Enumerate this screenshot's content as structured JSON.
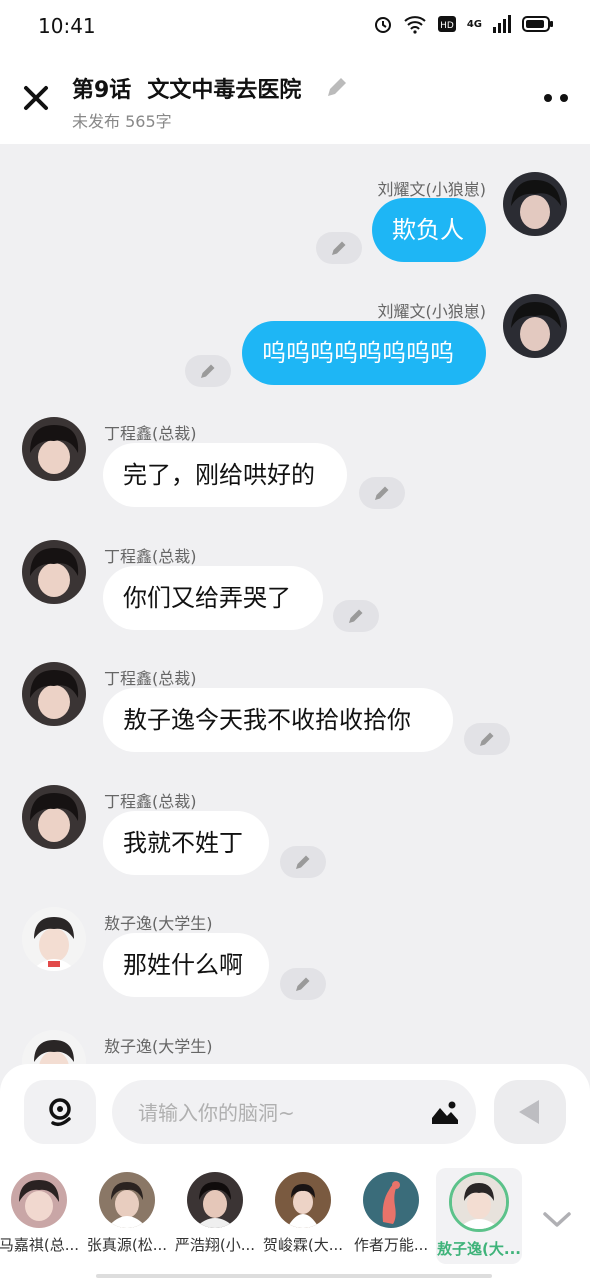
{
  "status": {
    "time": "10:41",
    "network_label": "4G"
  },
  "header": {
    "title_num": "第9话",
    "title_text": "文文中毒去医院",
    "subtitle": "未发布 565字"
  },
  "messages": [
    {
      "side": "right",
      "name": "刘耀文(小狼崽)",
      "text": "欺负人",
      "avatar": "dark"
    },
    {
      "side": "right",
      "name": "刘耀文(小狼崽)",
      "text": "呜呜呜呜呜呜呜呜",
      "avatar": "dark"
    },
    {
      "side": "left",
      "name": "丁程鑫(总裁)",
      "text": "完了，刚给哄好的",
      "avatar": "dark"
    },
    {
      "side": "left",
      "name": "丁程鑫(总裁)",
      "text": "你们又给弄哭了",
      "avatar": "dark"
    },
    {
      "side": "left",
      "name": "丁程鑫(总裁)",
      "text": "敖子逸今天我不收拾收拾你",
      "avatar": "dark"
    },
    {
      "side": "left",
      "name": "丁程鑫(总裁)",
      "text": "我就不姓丁",
      "avatar": "dark"
    },
    {
      "side": "left",
      "name": "敖子逸(大学生)",
      "text": "那姓什么啊",
      "avatar": "light"
    },
    {
      "side": "left",
      "name": "敖子逸(大学生)",
      "text": "",
      "avatar": "light"
    }
  ],
  "composer": {
    "placeholder": "请输入你的脑洞~"
  },
  "characters": [
    {
      "name": "马嘉祺(总...",
      "selected": false,
      "color": "#c9a6a6"
    },
    {
      "name": "张真源(松...",
      "selected": false,
      "color": "#8a7766"
    },
    {
      "name": "严浩翔(小...",
      "selected": false,
      "color": "#3b3434"
    },
    {
      "name": "贺峻霖(大...",
      "selected": false,
      "color": "#7a5a40"
    },
    {
      "name": "作者万能...",
      "selected": false,
      "color": "#3a6c7a"
    },
    {
      "name": "敖子逸(大...",
      "selected": true,
      "color": "#e7e2dc"
    }
  ],
  "colors": {
    "bubble_right": "#1eb6f5",
    "selected_green": "#3fb37a"
  }
}
